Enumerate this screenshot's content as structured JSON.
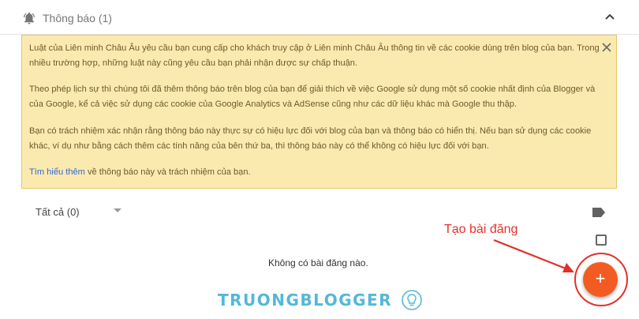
{
  "header": {
    "title": "Thông báo (1)",
    "icon": "bell-icon",
    "collapse_icon": "chevron-up-icon"
  },
  "notice": {
    "p1": "Luật của Liên minh Châu Âu yêu cầu bạn cung cấp cho khách truy cập ở Liên minh Châu Âu thông tin về các cookie dùng trên blog của bạn. Trong nhiều trường hợp, những luật này cũng yêu cầu bạn phải nhận được sự chấp thuận.",
    "p2": "Theo phép lịch sự thì chúng tôi đã thêm thông báo trên blog của bạn để giải thích về việc Google sử dụng một số cookie nhất định của Blogger và của Google, kể cả việc sử dụng các cookie của Google Analytics và AdSense cũng như các dữ liệu khác mà Google thu thập.",
    "p3": "Bạn có trách nhiệm xác nhận rằng thông báo này thực sự có hiệu lực đối với blog của bạn và thông báo có hiển thị. Nếu bạn sử dụng các cookie khác, ví dụ như bằng cách thêm các tính năng của bên thứ ba, thì thông báo này có thể không có hiệu lực đối với bạn.",
    "link": "Tìm hiểu thêm",
    "p4_rest": " về thông báo này và trách nhiệm của bạn.",
    "bg_color": "#fbeab0",
    "border_color": "#e8c46a"
  },
  "filter": {
    "selected": "Tất cả (0)"
  },
  "posts": {
    "empty_text": "Không có bài đăng nào."
  },
  "annotation": {
    "text": "Tạo bài đăng",
    "color": "#e8302a"
  },
  "fab": {
    "label": "+",
    "color": "#f25c22"
  },
  "watermark": {
    "text": "TRUONGBLOGGER",
    "color": "#53b8d9"
  }
}
